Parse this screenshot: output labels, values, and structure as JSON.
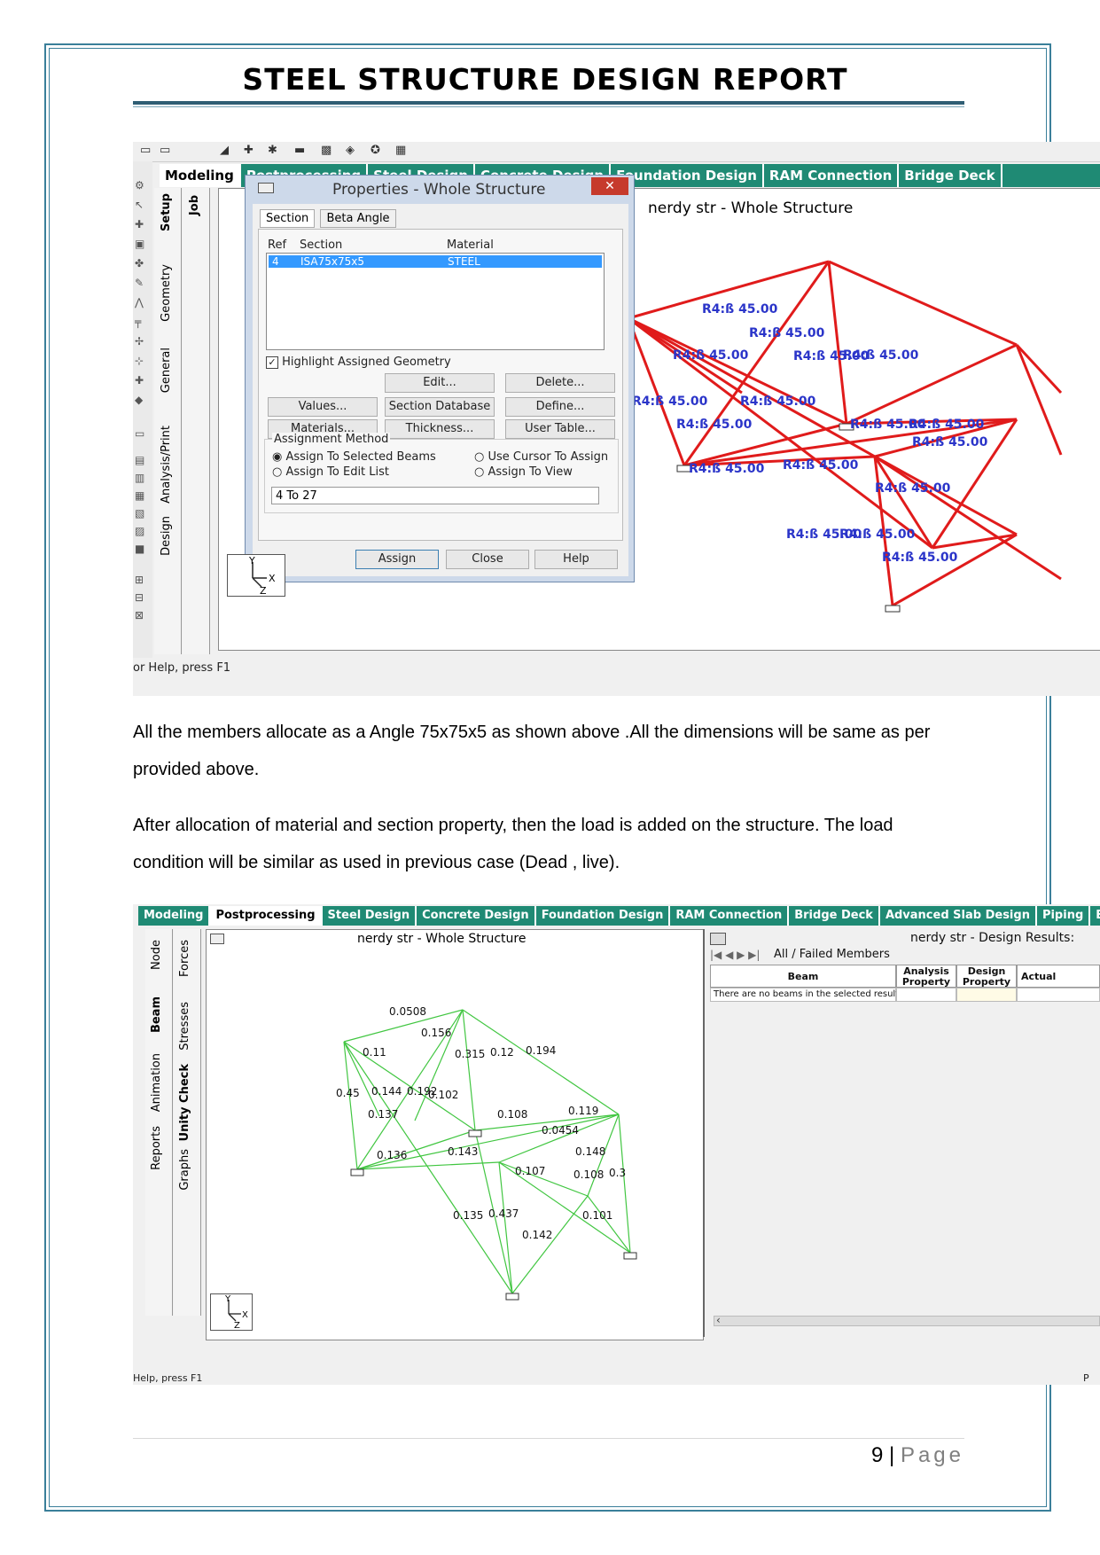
{
  "header": {
    "title": "STEEL STRUCTURE DESIGN REPORT"
  },
  "screenshot1": {
    "tabs": [
      "Modeling",
      "Postprocessing",
      "Steel Design",
      "Concrete Design",
      "Foundation Design",
      "RAM Connection",
      "Bridge Deck"
    ],
    "vertical_tabs": [
      "Setup",
      "Geometry",
      "General",
      "Analysis/Print",
      "Design"
    ],
    "job_tab": "Job",
    "viewport_title": "nerdy str - Whole Structure",
    "dialog": {
      "title": "Properties - Whole Structure",
      "close_glyph": "✕",
      "tabs": [
        "Section",
        "Beta Angle"
      ],
      "columns": {
        "ref": "Ref",
        "section": "Section",
        "material": "Material"
      },
      "row": {
        "ref": "4",
        "section": "ISA75x75x5",
        "material": "STEEL"
      },
      "highlight_label": "Highlight Assigned Geometry",
      "buttons": {
        "edit": "Edit...",
        "delete": "Delete...",
        "values": "Values...",
        "section_database": "Section Database",
        "define": "Define...",
        "materials": "Materials...",
        "thickness": "Thickness...",
        "user_table": "User Table...",
        "assign": "Assign",
        "close": "Close",
        "help": "Help"
      },
      "assignment_method": {
        "label": "Assignment Method",
        "selected_beams": "Assign To Selected Beams",
        "edit_list": "Assign To Edit List",
        "use_cursor": "Use Cursor To Assign",
        "assign_view": "Assign To View"
      },
      "edit_list_value": "4 To 27"
    },
    "member_labels": [
      "R4:ß 45.00",
      "R4:ß 45.00",
      "R4:ß 45.00",
      "R4:ß 45.00",
      "R4:ß 45.00",
      "R4:ß 45.00",
      "R4:ß 45.00",
      "R4:ß 45.00",
      "R4:ß 45.00",
      "R4:ß 45.00",
      "R4:ß 45.00",
      "R4:ß 45.00",
      "R4:ß 45.00",
      "R4:ß 45.00",
      "R4:ß 45.00",
      "R4:ß 45.00",
      "R4:ß 45.00"
    ],
    "status": "or Help, press F1"
  },
  "paragraphs": {
    "p1": "All the members allocate as a Angle 75x75x5 as shown above .All the dimensions will be same as per provided above.",
    "p2": "After allocation of material and section property, then the load is added on the structure. The load condition will be similar as used in previous case (Dead , live)."
  },
  "screenshot2": {
    "tabs": [
      "Modeling",
      "Postprocessing",
      "Steel Design",
      "Concrete Design",
      "Foundation Design",
      "RAM Connection",
      "Bridge Deck",
      "Advanced Slab Design",
      "Piping",
      "Earthqu"
    ],
    "vertical_tabs_a": [
      "Node",
      "Beam",
      "Animation",
      "Reports"
    ],
    "vertical_tabs_b": [
      "Forces",
      "Stresses",
      "Unity Check",
      "Graphs"
    ],
    "viewport_title": "nerdy str - Whole Structure",
    "ratios": [
      "0.0508",
      "0.156",
      "0.11",
      "0.315",
      "0.12",
      "0.194",
      "0.45",
      "0.144",
      "0.192",
      "0.102",
      "0.137",
      "0.108",
      "0.119",
      "0.0454",
      "0.136",
      "0.143",
      "0.148",
      "0.107",
      "0.108",
      "0.3",
      "0.135",
      "0.437",
      "0.101",
      "0.142"
    ],
    "results": {
      "title": "nerdy str - Design Results:",
      "tab_all": "All",
      "tab_failed": "Failed Members",
      "col_beam": "Beam",
      "col_analysis": "Analysis Property",
      "col_design": "Design Property",
      "col_actual": "Actual",
      "empty_message": "There are no beams in the selected results"
    },
    "status": "Help, press F1",
    "status_right": "P"
  },
  "footer": {
    "page_number": "9",
    "separator": "|",
    "page_word": "Page"
  },
  "colors": {
    "ribbon": "#1f8a74",
    "members_red": "#e01b1b",
    "members_green": "#41c641",
    "label_blue": "#2b35c9",
    "border": "#3a7f9a"
  }
}
